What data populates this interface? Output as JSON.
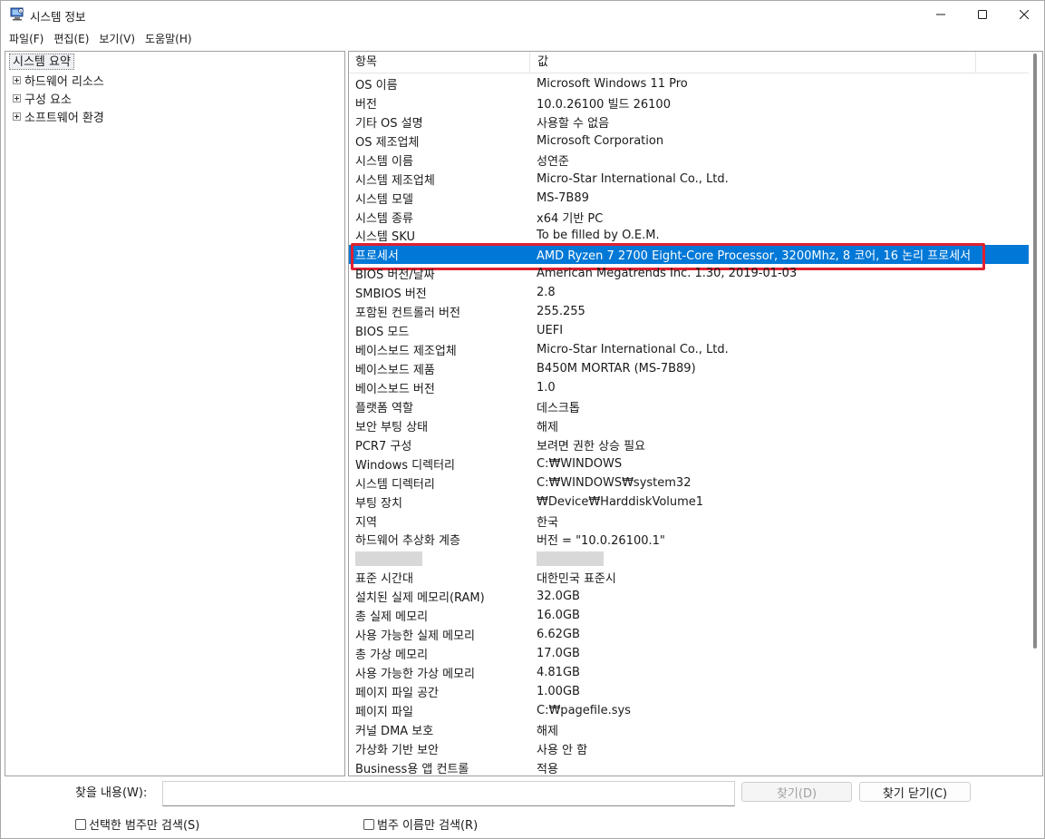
{
  "window": {
    "title": "시스템 정보"
  },
  "menu": {
    "items": [
      "파일(F)",
      "편집(E)",
      "보기(V)",
      "도움말(H)"
    ]
  },
  "tree": {
    "root": "시스템 요약",
    "children": [
      "하드웨어 리소스",
      "구성 요소",
      "소프트웨어 환경"
    ]
  },
  "list": {
    "headers": {
      "item": "항목",
      "value": "값"
    },
    "rows": [
      {
        "item": "OS 이름",
        "value": "Microsoft Windows 11 Pro"
      },
      {
        "item": "버전",
        "value": "10.0.26100 빌드 26100"
      },
      {
        "item": "기타 OS 설명",
        "value": "사용할 수 없음"
      },
      {
        "item": "OS 제조업체",
        "value": "Microsoft Corporation"
      },
      {
        "item": "시스템 이름",
        "value": "성연준"
      },
      {
        "item": "시스템 제조업체",
        "value": "Micro-Star International Co., Ltd."
      },
      {
        "item": "시스템 모델",
        "value": "MS-7B89"
      },
      {
        "item": "시스템 종류",
        "value": "x64 기반 PC"
      },
      {
        "item": "시스템 SKU",
        "value": "To be filled by O.E.M."
      },
      {
        "item": "프로세서",
        "value": "AMD Ryzen 7 2700 Eight-Core Processor, 3200Mhz, 8 코어, 16 논리 프로세서"
      },
      {
        "item": "BIOS 버전/날짜",
        "value": "American Megatrends Inc. 1.30, 2019-01-03"
      },
      {
        "item": "SMBIOS 버전",
        "value": "2.8"
      },
      {
        "item": "포함된 컨트롤러 버전",
        "value": "255.255"
      },
      {
        "item": "BIOS 모드",
        "value": "UEFI"
      },
      {
        "item": "베이스보드 제조업체",
        "value": "Micro-Star International Co., Ltd."
      },
      {
        "item": "베이스보드 제품",
        "value": "B450M MORTAR (MS-7B89)"
      },
      {
        "item": "베이스보드 버전",
        "value": "1.0"
      },
      {
        "item": "플랫폼 역할",
        "value": "데스크톱"
      },
      {
        "item": "보안 부팅 상태",
        "value": "해제"
      },
      {
        "item": "PCR7 구성",
        "value": "보려면 권한 상승 필요"
      },
      {
        "item": "Windows 디렉터리",
        "value": "C:₩WINDOWS"
      },
      {
        "item": "시스템 디렉터리",
        "value": "C:₩WINDOWS₩system32"
      },
      {
        "item": "부팅 장치",
        "value": "₩Device₩HarddiskVolume1"
      },
      {
        "item": "지역",
        "value": "한국"
      },
      {
        "item": "하드웨어 추상화 계층",
        "value": "버전 = \"10.0.26100.1\""
      },
      {
        "item": "",
        "value": ""
      },
      {
        "item": "표준 시간대",
        "value": "대한민국 표준시"
      },
      {
        "item": "설치된 실제 메모리(RAM)",
        "value": "32.0GB"
      },
      {
        "item": "총 실제 메모리",
        "value": "16.0GB"
      },
      {
        "item": "사용 가능한 실제 메모리",
        "value": "6.62GB"
      },
      {
        "item": "총 가상 메모리",
        "value": "17.0GB"
      },
      {
        "item": "사용 가능한 가상 메모리",
        "value": "4.81GB"
      },
      {
        "item": "페이지 파일 공간",
        "value": "1.00GB"
      },
      {
        "item": "페이지 파일",
        "value": "C:₩pagefile.sys"
      },
      {
        "item": "커널 DMA 보호",
        "value": "해제"
      },
      {
        "item": "가상화 기반 보안",
        "value": "사용 안 함"
      },
      {
        "item": "Business용 앱 컨트롤",
        "value": "적용"
      }
    ],
    "selected_index": 9,
    "redacted_index": 25
  },
  "search": {
    "label": "찾을 내용(W):",
    "input_value": "",
    "find_button": "찾기(D)",
    "close_button": "찾기 닫기(C)",
    "check_selected": "선택한 범주만 검색(S)",
    "check_category": "범주 이름만 검색(R)"
  },
  "colors": {
    "selection": "#0078d7",
    "highlight_border": "#e02030"
  }
}
